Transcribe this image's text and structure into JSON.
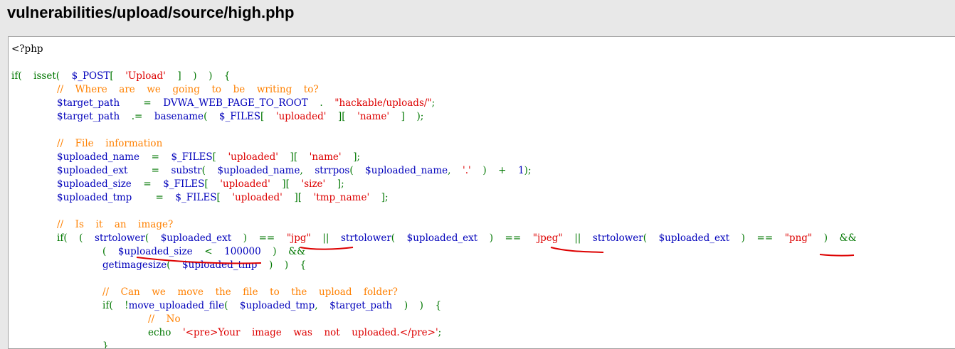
{
  "page": {
    "title": "vulnerabilities/upload/source/high.php"
  },
  "colors": {
    "keyword": "#007700",
    "variable": "#0000bb",
    "string": "#dd0000",
    "comment": "#ff8000",
    "plain": "#000000",
    "annotation": "#dd0000"
  },
  "code": {
    "lines": [
      {
        "indent": 0,
        "tokens": [
          {
            "c": "plain",
            "t": "<?php"
          }
        ]
      },
      {
        "indent": 0,
        "tokens": []
      },
      {
        "indent": 0,
        "tokens": [
          {
            "c": "kw",
            "t": "if(  isset(  "
          },
          {
            "c": "var",
            "t": "$_POST"
          },
          {
            "c": "kw",
            "t": "[  "
          },
          {
            "c": "str",
            "t": "'Upload'"
          },
          {
            "c": "kw",
            "t": "  ]  )  )  {"
          }
        ]
      },
      {
        "indent": 1,
        "tokens": [
          {
            "c": "com",
            "t": "//  Where  are  we  going  to  be  writing  to?"
          }
        ]
      },
      {
        "indent": 1,
        "tokens": [
          {
            "c": "var",
            "t": "$target_path    "
          },
          {
            "c": "kw",
            "t": "=  "
          },
          {
            "c": "var",
            "t": "DVWA_WEB_PAGE_TO_ROOT  "
          },
          {
            "c": "kw",
            "t": ".  "
          },
          {
            "c": "str",
            "t": "\"hackable/uploads/\""
          },
          {
            "c": "kw",
            "t": ";"
          }
        ]
      },
      {
        "indent": 1,
        "tokens": [
          {
            "c": "var",
            "t": "$target_path  "
          },
          {
            "c": "kw",
            "t": ".=  "
          },
          {
            "c": "var",
            "t": "basename"
          },
          {
            "c": "kw",
            "t": "(  "
          },
          {
            "c": "var",
            "t": "$_FILES"
          },
          {
            "c": "kw",
            "t": "[  "
          },
          {
            "c": "str",
            "t": "'uploaded'"
          },
          {
            "c": "kw",
            "t": "  ][  "
          },
          {
            "c": "str",
            "t": "'name'"
          },
          {
            "c": "kw",
            "t": "  ]  );"
          }
        ]
      },
      {
        "indent": 0,
        "tokens": []
      },
      {
        "indent": 1,
        "tokens": [
          {
            "c": "com",
            "t": "//  File  information"
          }
        ]
      },
      {
        "indent": 1,
        "tokens": [
          {
            "c": "var",
            "t": "$uploaded_name  "
          },
          {
            "c": "kw",
            "t": "=  "
          },
          {
            "c": "var",
            "t": "$_FILES"
          },
          {
            "c": "kw",
            "t": "[  "
          },
          {
            "c": "str",
            "t": "'uploaded'"
          },
          {
            "c": "kw",
            "t": "  ][  "
          },
          {
            "c": "str",
            "t": "'name'"
          },
          {
            "c": "kw",
            "t": "  ];"
          }
        ]
      },
      {
        "indent": 1,
        "tokens": [
          {
            "c": "var",
            "t": "$uploaded_ext    "
          },
          {
            "c": "kw",
            "t": "=  "
          },
          {
            "c": "var",
            "t": "substr"
          },
          {
            "c": "kw",
            "t": "(  "
          },
          {
            "c": "var",
            "t": "$uploaded_name"
          },
          {
            "c": "kw",
            "t": ",  "
          },
          {
            "c": "var",
            "t": "strrpos"
          },
          {
            "c": "kw",
            "t": "(  "
          },
          {
            "c": "var",
            "t": "$uploaded_name"
          },
          {
            "c": "kw",
            "t": ",  "
          },
          {
            "c": "str",
            "t": "'.'"
          },
          {
            "c": "kw",
            "t": "  )  +  "
          },
          {
            "c": "var",
            "t": "1"
          },
          {
            "c": "kw",
            "t": ");"
          }
        ]
      },
      {
        "indent": 1,
        "tokens": [
          {
            "c": "var",
            "t": "$uploaded_size  "
          },
          {
            "c": "kw",
            "t": "=  "
          },
          {
            "c": "var",
            "t": "$_FILES"
          },
          {
            "c": "kw",
            "t": "[  "
          },
          {
            "c": "str",
            "t": "'uploaded'"
          },
          {
            "c": "kw",
            "t": "  ][  "
          },
          {
            "c": "str",
            "t": "'size'"
          },
          {
            "c": "kw",
            "t": "  ];"
          }
        ]
      },
      {
        "indent": 1,
        "tokens": [
          {
            "c": "var",
            "t": "$uploaded_tmp    "
          },
          {
            "c": "kw",
            "t": "=  "
          },
          {
            "c": "var",
            "t": "$_FILES"
          },
          {
            "c": "kw",
            "t": "[  "
          },
          {
            "c": "str",
            "t": "'uploaded'"
          },
          {
            "c": "kw",
            "t": "  ][  "
          },
          {
            "c": "str",
            "t": "'tmp_name'"
          },
          {
            "c": "kw",
            "t": "  ];"
          }
        ]
      },
      {
        "indent": 0,
        "tokens": []
      },
      {
        "indent": 1,
        "tokens": [
          {
            "c": "com",
            "t": "//  Is  it  an  image?"
          }
        ]
      },
      {
        "indent": 1,
        "tokens": [
          {
            "c": "kw",
            "t": "if(  (  "
          },
          {
            "c": "var",
            "t": "strtolower"
          },
          {
            "c": "kw",
            "t": "(  "
          },
          {
            "c": "var",
            "t": "$uploaded_ext  "
          },
          {
            "c": "kw",
            "t": ")  ==  "
          },
          {
            "c": "str",
            "t": "\"jpg\""
          },
          {
            "c": "kw",
            "t": "  ||  "
          },
          {
            "c": "var",
            "t": "strtolower"
          },
          {
            "c": "kw",
            "t": "(  "
          },
          {
            "c": "var",
            "t": "$uploaded_ext  "
          },
          {
            "c": "kw",
            "t": ")  ==  "
          },
          {
            "c": "str",
            "t": "\"jpeg\""
          },
          {
            "c": "kw",
            "t": "  ||  "
          },
          {
            "c": "var",
            "t": "strtolower"
          },
          {
            "c": "kw",
            "t": "(  "
          },
          {
            "c": "var",
            "t": "$uploaded_ext  "
          },
          {
            "c": "kw",
            "t": ")  ==  "
          },
          {
            "c": "str",
            "t": "\"png\""
          },
          {
            "c": "kw",
            "t": "  )  &&"
          }
        ]
      },
      {
        "indent": 2,
        "tokens": [
          {
            "c": "kw",
            "t": "(  "
          },
          {
            "c": "var",
            "t": "$uploaded_size  "
          },
          {
            "c": "kw",
            "t": "<  "
          },
          {
            "c": "var",
            "t": "100000  "
          },
          {
            "c": "kw",
            "t": ")  &&"
          }
        ]
      },
      {
        "indent": 2,
        "tokens": [
          {
            "c": "var",
            "t": "getimagesize"
          },
          {
            "c": "kw",
            "t": "(  "
          },
          {
            "c": "var",
            "t": "$uploaded_tmp  "
          },
          {
            "c": "kw",
            "t": ")  )  {"
          }
        ]
      },
      {
        "indent": 0,
        "tokens": []
      },
      {
        "indent": 2,
        "tokens": [
          {
            "c": "com",
            "t": "//  Can  we  move  the  file  to  the  upload  folder?"
          }
        ]
      },
      {
        "indent": 2,
        "tokens": [
          {
            "c": "kw",
            "t": "if(  !"
          },
          {
            "c": "var",
            "t": "move_uploaded_file"
          },
          {
            "c": "kw",
            "t": "(  "
          },
          {
            "c": "var",
            "t": "$uploaded_tmp"
          },
          {
            "c": "kw",
            "t": ",  "
          },
          {
            "c": "var",
            "t": "$target_path  "
          },
          {
            "c": "kw",
            "t": ")  )  {"
          }
        ]
      },
      {
        "indent": 3,
        "tokens": [
          {
            "c": "com",
            "t": "//  No"
          }
        ]
      },
      {
        "indent": 3,
        "tokens": [
          {
            "c": "kw",
            "t": "echo  "
          },
          {
            "c": "str",
            "t": "'<pre>Your  image  was  not  uploaded.</pre>'"
          },
          {
            "c": "kw",
            "t": ";"
          }
        ]
      },
      {
        "indent": 2,
        "tokens": [
          {
            "c": "kw",
            "t": "}"
          }
        ]
      }
    ]
  }
}
